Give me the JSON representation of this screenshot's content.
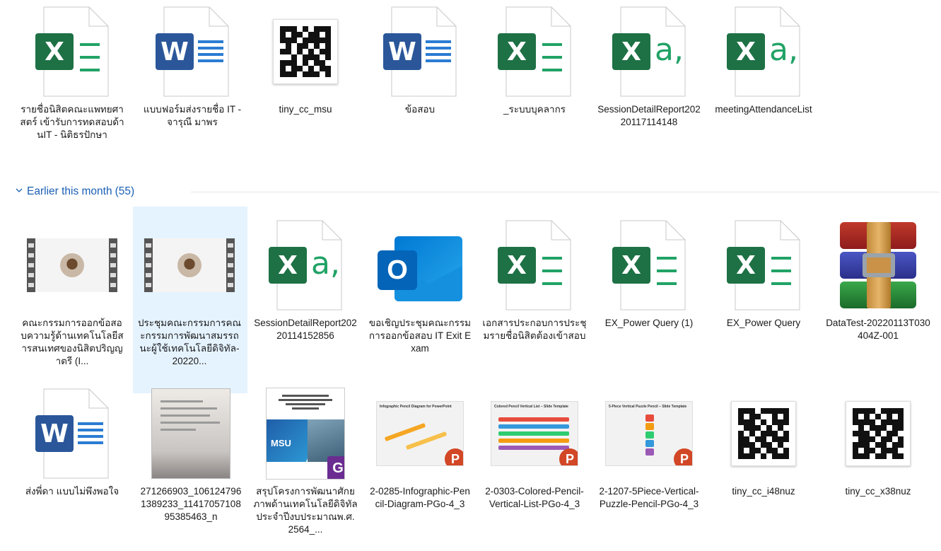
{
  "group": {
    "title": "Earlier this month",
    "count": "(55)"
  },
  "items": [
    {
      "label": "รายชื่อนิสิตคณะแพทยศาสตร์ เข้ารับการทดสอบด้านIT - นิติธรปักษา",
      "icon": "excel-file-icon"
    },
    {
      "label": "แบบฟอร์มส่งรายชื่อ IT - จารุณี มาพร",
      "icon": "word-file-icon"
    },
    {
      "label": "tiny_cc_msu",
      "icon": "qr-code-icon"
    },
    {
      "label": "ข้อสอบ",
      "icon": "word-file-icon"
    },
    {
      "label": "_ระบบบุคลากร",
      "icon": "excel-file-icon"
    },
    {
      "label": "SessionDetailReport20220117114148",
      "icon": "csv-file-icon"
    },
    {
      "label": "meetingAttendanceList",
      "icon": "csv-file-icon"
    },
    {
      "label": "คณะกรรมการออกข้อสอบความรู้ด้านเทคโนโลยีสารสนเทศของนิสิตปริญญาตรี (I...",
      "icon": "video-file-icon"
    },
    {
      "label": "ประชุมคณะกรรมการคณะกรรมการพัฒนาสมรรถนะผู้ใช้เทคโนโลยีดิจิทัล-20220...",
      "icon": "video-file-icon"
    },
    {
      "label": "SessionDetailReport20220114152856",
      "icon": "csv-file-icon"
    },
    {
      "label": "ขอเชิญประชุมคณะกรรมการออกข้อสอบ IT Exit Exam",
      "icon": "outlook-message-icon"
    },
    {
      "label": "เอกสารประกอบการประชุมรายชื่อนิสิตต้องเข้าสอบ",
      "icon": "excel-file-icon"
    },
    {
      "label": "EX_Power Query (1)",
      "icon": "excel-file-icon"
    },
    {
      "label": "EX_Power Query",
      "icon": "excel-file-icon"
    },
    {
      "label": "DataTest-20220113T030404Z-001",
      "icon": "winrar-archive-icon"
    },
    {
      "label": "ส่งพี่ดา แบบไม่พึงพอใจ",
      "icon": "word-file-icon"
    },
    {
      "label": "271266903_1061247961389233_1141705710895385463_n",
      "icon": "scanned-image-icon"
    },
    {
      "label": "สรุปโครงการพัฒนาศักยภาพด้านเทคโนโลยีดิจิทัลประจำปีงบประมาณพ.ศ. 2564_...",
      "icon": "pdf-file-icon"
    },
    {
      "label": "2-0285-Infographic-Pencil-Diagram-PGo-4_3",
      "icon": "powerpoint-file-icon",
      "slide_title": "Infographic Pencil Diagram for PowerPoint"
    },
    {
      "label": "2-0303-Colored-Pencil-Vertical-List-PGo-4_3",
      "icon": "powerpoint-file-icon",
      "slide_title": "Colored Pencil Vertical List – Slide Template"
    },
    {
      "label": "2-1207-5Piece-Vertical-Puzzle-Pencil-PGo-4_3",
      "icon": "powerpoint-file-icon",
      "slide_title": "5-Piece Vertical Puzzle Pencil – Slide Template"
    },
    {
      "label": "tiny_cc_i48nuz",
      "icon": "qr-code-icon"
    },
    {
      "label": "tiny_cc_x38nuz",
      "icon": "qr-code-icon"
    }
  ],
  "badges": {
    "excel": "X",
    "word": "W",
    "csv_glyph": "a,",
    "outlook": "O",
    "powerpoint": "P",
    "pdf": "G",
    "pdf_cover_text": "MSU"
  },
  "colors": {
    "excel": "#1e7145",
    "word": "#2b579a",
    "accent": "#1a5fb4",
    "selection": "#e5f3ff"
  }
}
